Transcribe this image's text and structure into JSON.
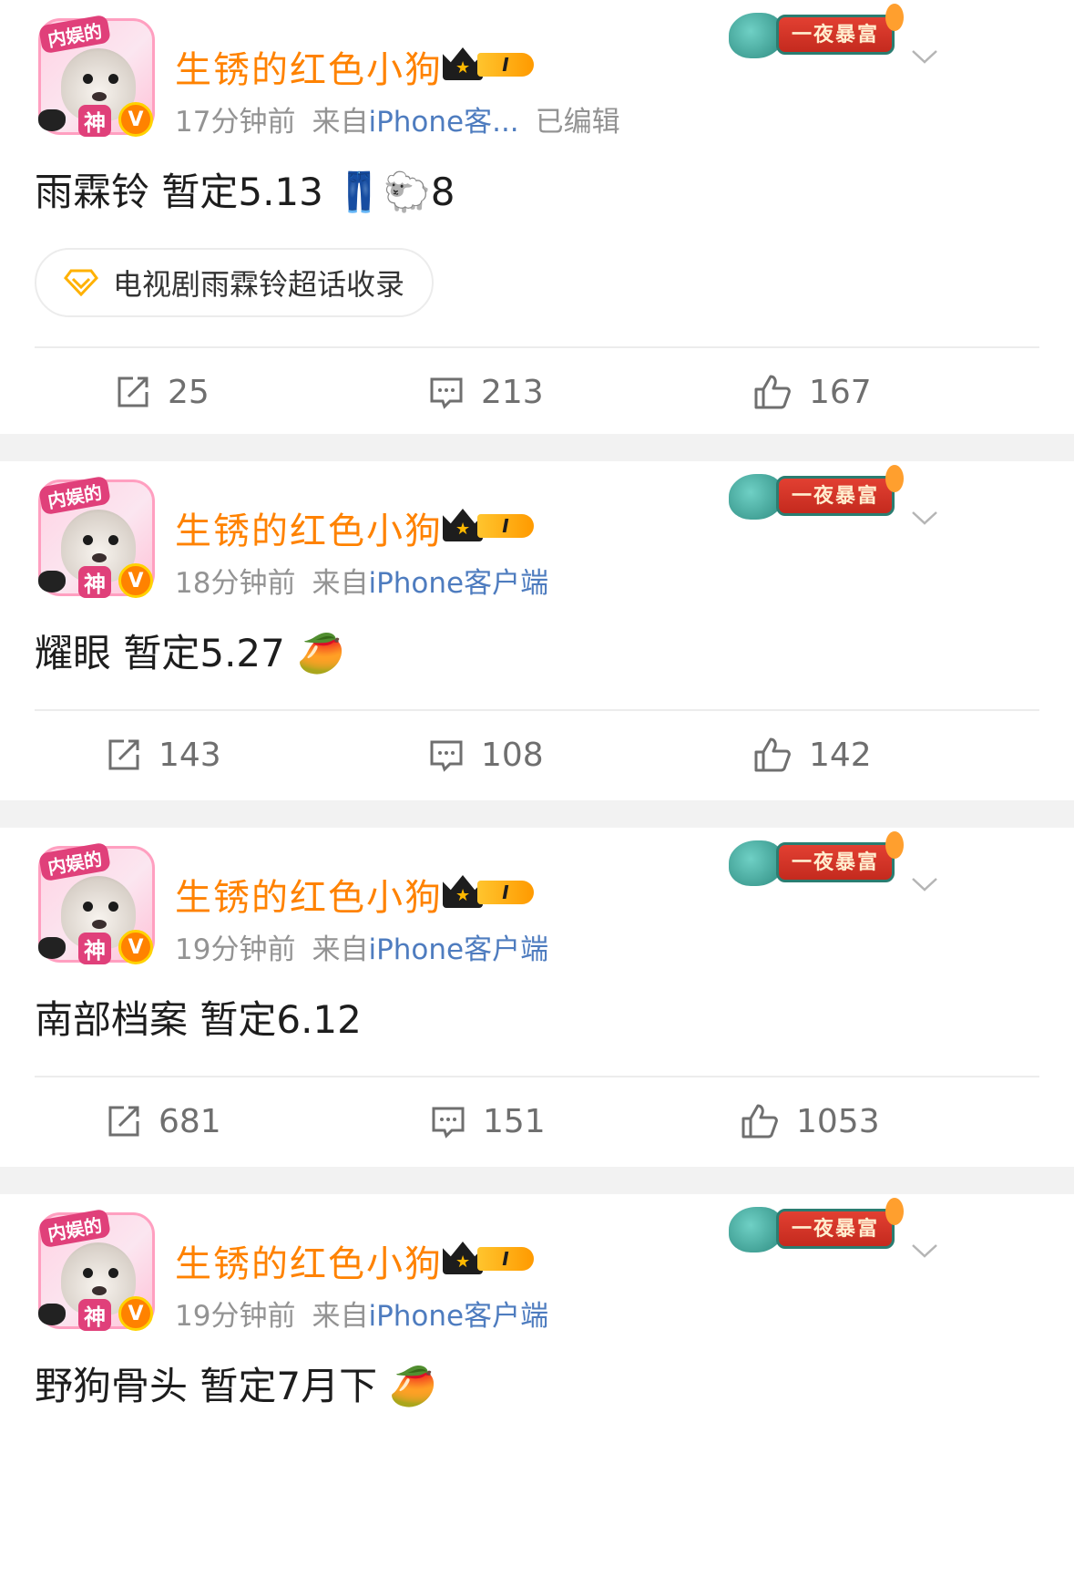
{
  "posts": [
    {
      "author": "生锈的红色小狗",
      "avatar_tag": "内娱的",
      "avatar_tag2": "神",
      "verified_mark": "V",
      "vip_level": "I",
      "promo_text": "一夜暴富",
      "time": "17分钟前",
      "source_prefix": "来自",
      "source": "iPhone客...",
      "edited": "已编辑",
      "text": "雨霖铃 暂定5.13 👖🐑8",
      "topic": "电视剧雨霖铃超话收录",
      "reposts": "25",
      "comments": "213",
      "likes": "167"
    },
    {
      "author": "生锈的红色小狗",
      "avatar_tag": "内娱的",
      "avatar_tag2": "神",
      "verified_mark": "V",
      "vip_level": "I",
      "promo_text": "一夜暴富",
      "time": "18分钟前",
      "source_prefix": "来自",
      "source": "iPhone客户端",
      "text": "耀眼 暂定5.27 🥭",
      "reposts": "143",
      "comments": "108",
      "likes": "142"
    },
    {
      "author": "生锈的红色小狗",
      "avatar_tag": "内娱的",
      "avatar_tag2": "神",
      "verified_mark": "V",
      "vip_level": "I",
      "promo_text": "一夜暴富",
      "time": "19分钟前",
      "source_prefix": "来自",
      "source": "iPhone客户端",
      "text": "南部档案 暂定6.12",
      "reposts": "681",
      "comments": "151",
      "likes": "1053"
    },
    {
      "author": "生锈的红色小狗",
      "avatar_tag": "内娱的",
      "avatar_tag2": "神",
      "verified_mark": "V",
      "vip_level": "I",
      "promo_text": "一夜暴富",
      "time": "19分钟前",
      "source_prefix": "来自",
      "source": "iPhone客户端",
      "text": "野狗骨头 暂定7月下 🥭"
    }
  ],
  "colors": {
    "author": "#ff8200",
    "source_link": "#4e7cbf",
    "meta": "#939393",
    "background": "#f2f2f2"
  },
  "icons": [
    "repost-icon",
    "comment-icon",
    "like-icon",
    "chevron-down-icon",
    "super-topic-icon"
  ]
}
